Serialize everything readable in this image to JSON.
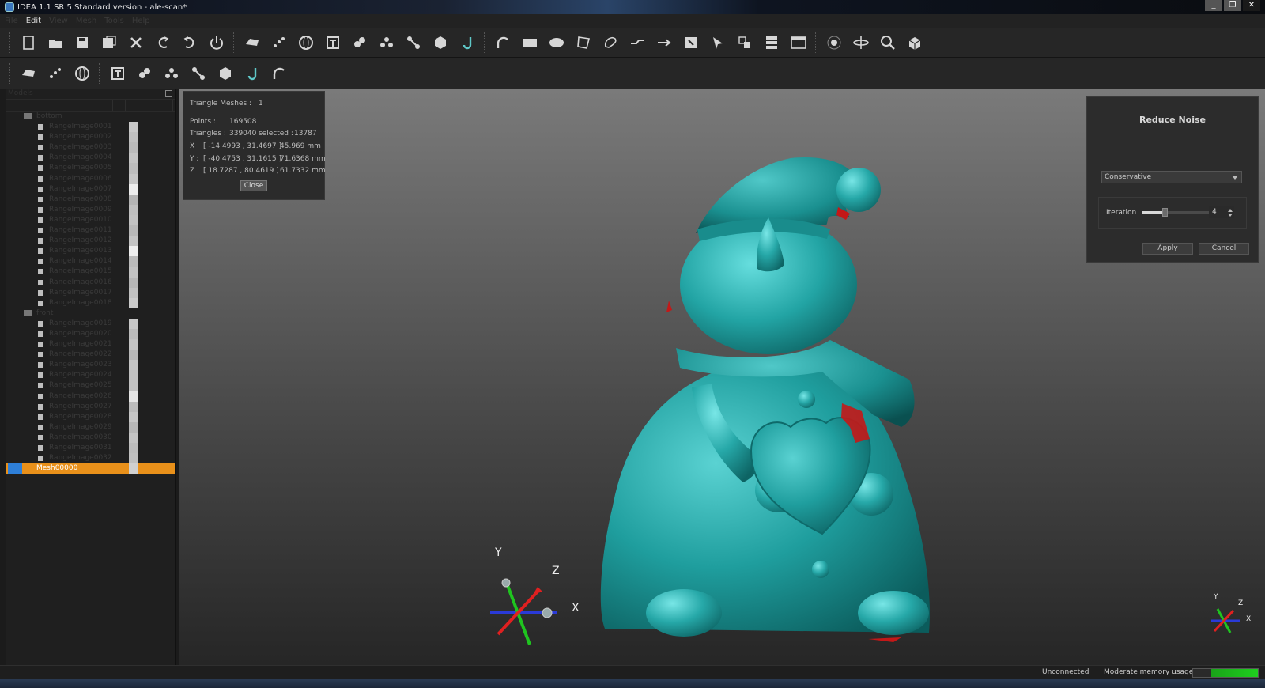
{
  "window": {
    "title": "IDEA 1.1 SR 5 Standard version - ale-scan*"
  },
  "menu": {
    "items": [
      "File",
      "Edit",
      "View",
      "Mesh",
      "Tools",
      "Help"
    ],
    "active_index": 1
  },
  "toolbar1": {
    "icons": [
      "new-file-icon",
      "open-folder-icon",
      "save-icon",
      "save-as-icon",
      "delete-x-icon",
      "undo-icon",
      "redo-icon",
      "power-icon",
      "scanner-icon",
      "point-cloud-icon",
      "globe-sphere-icon",
      "align-icon",
      "merge-icon",
      "fuse-icon",
      "scatter-icon",
      "hexagon-icon",
      "curve-j-icon",
      "arc-icon",
      "rectangle-select-icon",
      "ellipse-select-icon",
      "polygon-select-icon",
      "lasso-icon",
      "line-segment-icon",
      "arrow-line-icon",
      "invert-select-icon",
      "cursor-select-icon",
      "transform-icon",
      "layers-icon",
      "window-icon",
      "view-cube-small-icon",
      "rotate-axis-icon",
      "zoom-icon",
      "cube-view-icon"
    ]
  },
  "toolbar2": {
    "icons": [
      "light-icon",
      "shading-icon",
      "texture-color-icon",
      "edit-tool-1-icon",
      "edit-tool-2-icon",
      "edit-tool-3-icon",
      "edit-tool-4-icon",
      "edit-tool-5-icon",
      "surface-icon",
      "measure-icon"
    ]
  },
  "tree": {
    "header": "Models",
    "groups": [
      {
        "label": "bottom",
        "items": [
          {
            "label": "RangeImage0001",
            "shade": "#c9c9c9"
          },
          {
            "label": "RangeImage0002",
            "shade": "#c0c0c0"
          },
          {
            "label": "RangeImage0003",
            "shade": "#bababa"
          },
          {
            "label": "RangeImage0004",
            "shade": "#c4c4c4"
          },
          {
            "label": "RangeImage0005",
            "shade": "#bdbdbd"
          },
          {
            "label": "RangeImage0006",
            "shade": "#c6c6c6"
          },
          {
            "label": "RangeImage0007",
            "shade": "#ececec"
          },
          {
            "label": "RangeImage0008",
            "shade": "#b4b4b4"
          },
          {
            "label": "RangeImage0009",
            "shade": "#bfbfbf"
          },
          {
            "label": "RangeImage0010",
            "shade": "#c2c2c2"
          },
          {
            "label": "RangeImage0011",
            "shade": "#b8b8b8"
          },
          {
            "label": "RangeImage0012",
            "shade": "#c4c4c4"
          },
          {
            "label": "RangeImage0013",
            "shade": "#eeeeee"
          },
          {
            "label": "RangeImage0014",
            "shade": "#bbbbbb"
          },
          {
            "label": "RangeImage0015",
            "shade": "#c2c2c2"
          },
          {
            "label": "RangeImage0016",
            "shade": "#b6b6b6"
          },
          {
            "label": "RangeImage0017",
            "shade": "#c0c0c0"
          },
          {
            "label": "RangeImage0018",
            "shade": "#cacaca"
          }
        ]
      },
      {
        "label": "front",
        "items": [
          {
            "label": "RangeImage0019",
            "shade": "#c8c8c8"
          },
          {
            "label": "RangeImage0020",
            "shade": "#bcbcbc"
          },
          {
            "label": "RangeImage0021",
            "shade": "#c3c3c3"
          },
          {
            "label": "RangeImage0022",
            "shade": "#b9b9b9"
          },
          {
            "label": "RangeImage0023",
            "shade": "#c5c5c5"
          },
          {
            "label": "RangeImage0024",
            "shade": "#bfbfbf"
          },
          {
            "label": "RangeImage0025",
            "shade": "#c1c1c1"
          },
          {
            "label": "RangeImage0026",
            "shade": "#e4e4e4"
          },
          {
            "label": "RangeImage0027",
            "shade": "#bbbbbb"
          },
          {
            "label": "RangeImage0028",
            "shade": "#c6c6c6"
          },
          {
            "label": "RangeImage0029",
            "shade": "#b7b7b7"
          },
          {
            "label": "RangeImage0030",
            "shade": "#c4c4c4"
          },
          {
            "label": "RangeImage0031",
            "shade": "#bdbdbd"
          },
          {
            "label": "RangeImage0032",
            "shade": "#c0c0c0"
          }
        ]
      }
    ],
    "selected": {
      "label": "Mesh00000",
      "shade": "#d0d0d0"
    }
  },
  "info": {
    "triangle_meshes_label": "Triangle Meshes :",
    "triangle_meshes_value": "1",
    "points_label": "Points :",
    "points_value": "169508",
    "triangles_label": "Triangles :",
    "triangles_value": "339040",
    "selected_label": "selected :",
    "selected_value": "13787",
    "x_label": "X :",
    "x_range": "[ -14.4993 , 31.4697 ]",
    "x_size": "45.969 mm",
    "y_label": "Y :",
    "y_range": "[ -40.4753 , 31.1615 ]",
    "y_size": "71.6368 mm",
    "z_label": "Z :",
    "z_range": "[ 18.7287 , 80.4619 ]",
    "z_size": "61.7332 mm",
    "close_label": "Close"
  },
  "reduce_noise": {
    "title": "Reduce Noise",
    "mode": "Conservative",
    "iteration_label": "Iteration",
    "iteration_value": "4",
    "iteration_fraction": 0.28,
    "apply_label": "Apply",
    "cancel_label": "Cancel"
  },
  "axes": {
    "x": "X",
    "y": "Y",
    "z": "Z"
  },
  "status": {
    "connection": "Unconnected",
    "memory_label": "Moderate memory usage",
    "memory_fraction": 0.72
  },
  "colors": {
    "mesh": "#1e9a9a",
    "mesh_highlight": "#5fd6d6",
    "selection_red": "#c41818",
    "tree_selected": "#e8901a",
    "memory_green": "#1ecf1e"
  }
}
